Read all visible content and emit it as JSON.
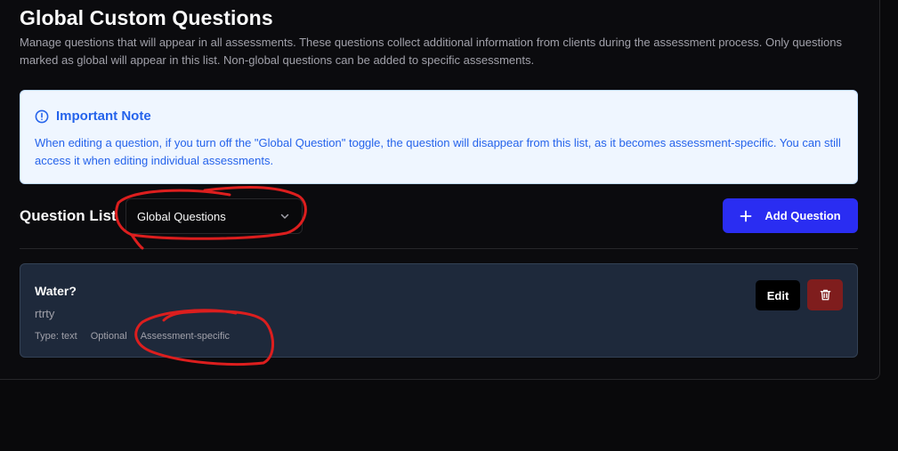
{
  "header": {
    "title": "Global Custom Questions",
    "description": "Manage questions that will appear in all assessments. These questions collect additional information from clients during the assessment process. Only questions marked as global will appear in this list. Non-global questions can be added to specific assessments."
  },
  "note": {
    "icon": "info-icon",
    "title": "Important Note",
    "body": "When editing a question, if you turn off the \"Global Question\" toggle, the question will disappear from this list, as it becomes assessment-specific. You can still access it when editing individual assessments."
  },
  "question_list": {
    "label": "Question List",
    "filter_select": {
      "value": "Global Questions",
      "icon": "chevron-down-icon"
    },
    "add_button": {
      "label": "Add Question",
      "icon": "plus-icon"
    }
  },
  "questions": [
    {
      "title": "Water?",
      "description": "rtrty",
      "type": "Type: text",
      "required": "Optional",
      "scope": "Assessment-specific",
      "edit_label": "Edit",
      "delete_icon": "trash-icon"
    }
  ],
  "colors": {
    "background": "#09090b",
    "accent": "#2a2df2",
    "note_bg": "#eff6ff",
    "note_text": "#2563eb",
    "card_bg": "#1e293b",
    "delete_bg": "#7f1d1d",
    "annotation": "#dc1e1e"
  }
}
